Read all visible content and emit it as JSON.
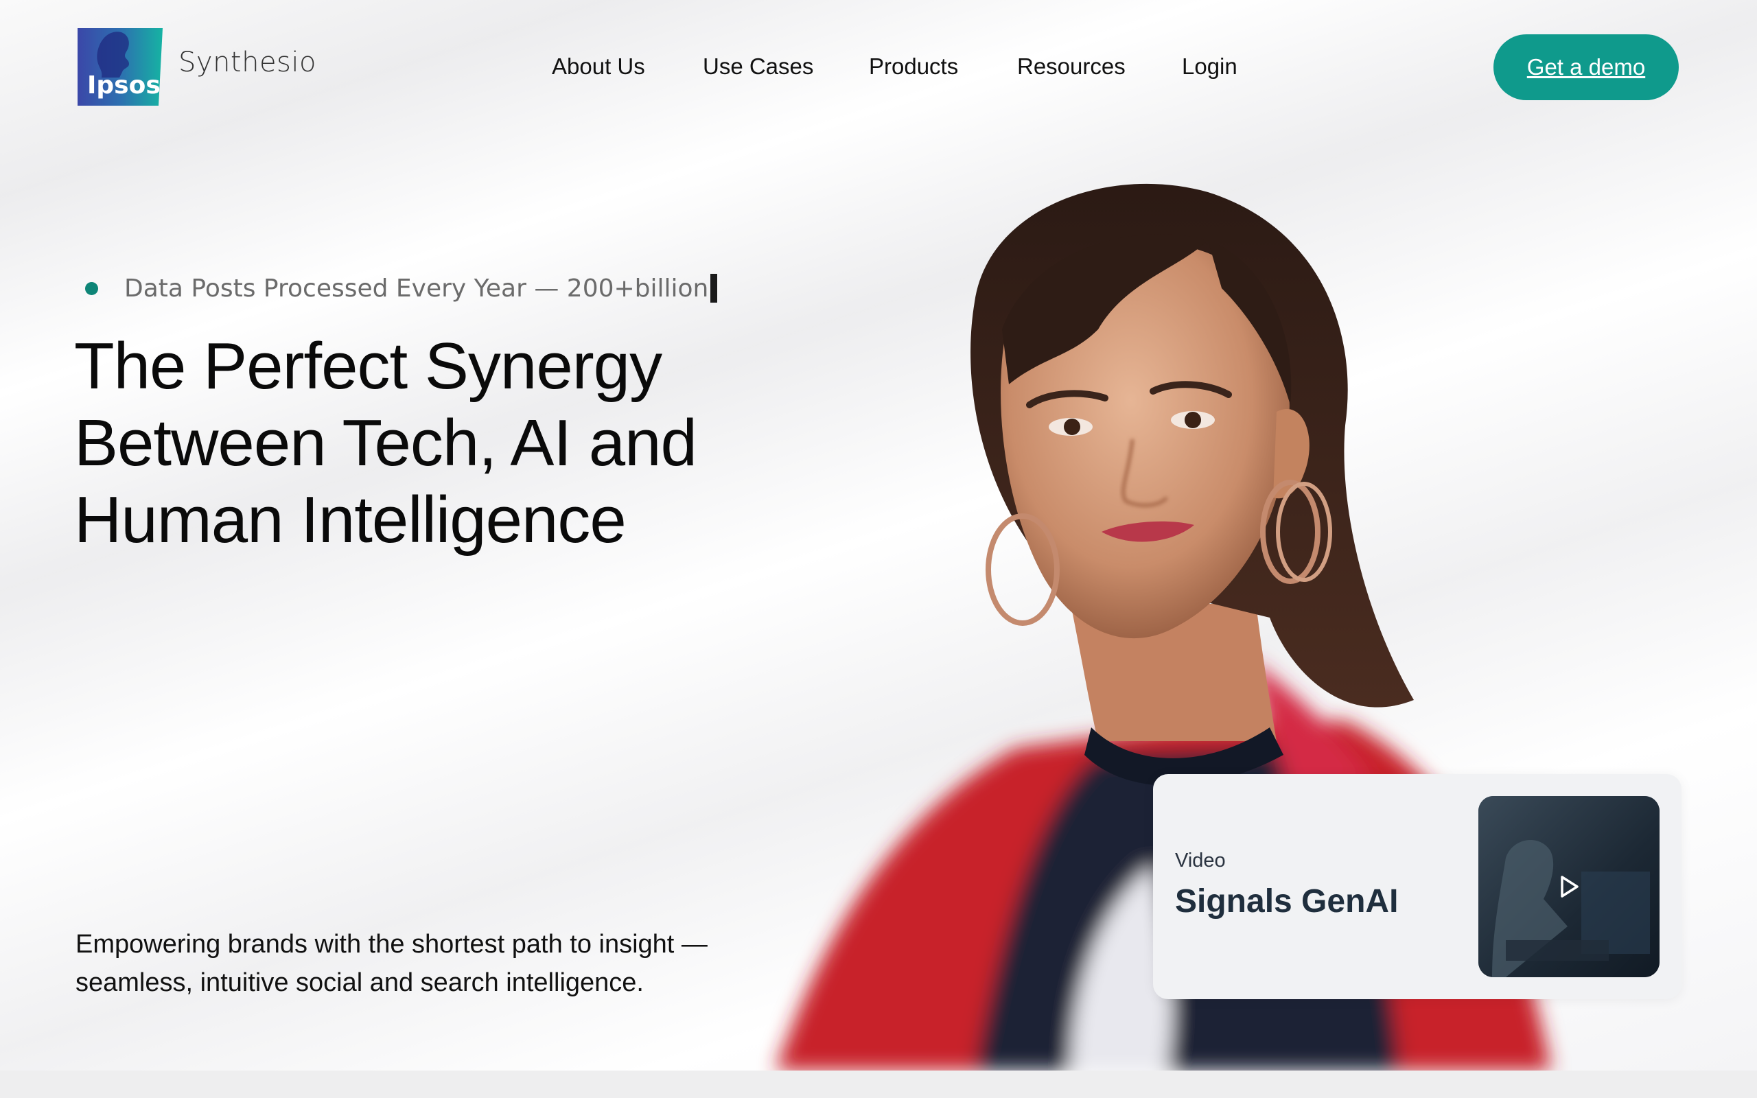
{
  "header": {
    "logo_text": "Ipsos",
    "brand_name": "Synthesio",
    "nav": [
      {
        "label": "About Us"
      },
      {
        "label": "Use Cases"
      },
      {
        "label": "Products"
      },
      {
        "label": "Resources"
      },
      {
        "label": "Login"
      }
    ],
    "cta_label": "Get a demo"
  },
  "hero": {
    "stat_text": "Data Posts Processed Every Year — 200+billion",
    "headline_lines": [
      "The Perfect Synergy",
      "Between Tech, AI and",
      "Human Intelligence"
    ],
    "subtext_lines": [
      "Empowering brands with the shortest path to insight —",
      "seamless, intuitive social and search intelligence."
    ]
  },
  "video_card": {
    "label": "Video",
    "title": "Signals GenAI"
  },
  "colors": {
    "accent": "#0f9a8c",
    "stat_dot": "#0e8577",
    "logo_blue": "#3b47a8",
    "logo_teal": "#16b3a3"
  },
  "icons": [
    "ipsos-logo",
    "play-icon",
    "status-dot"
  ]
}
